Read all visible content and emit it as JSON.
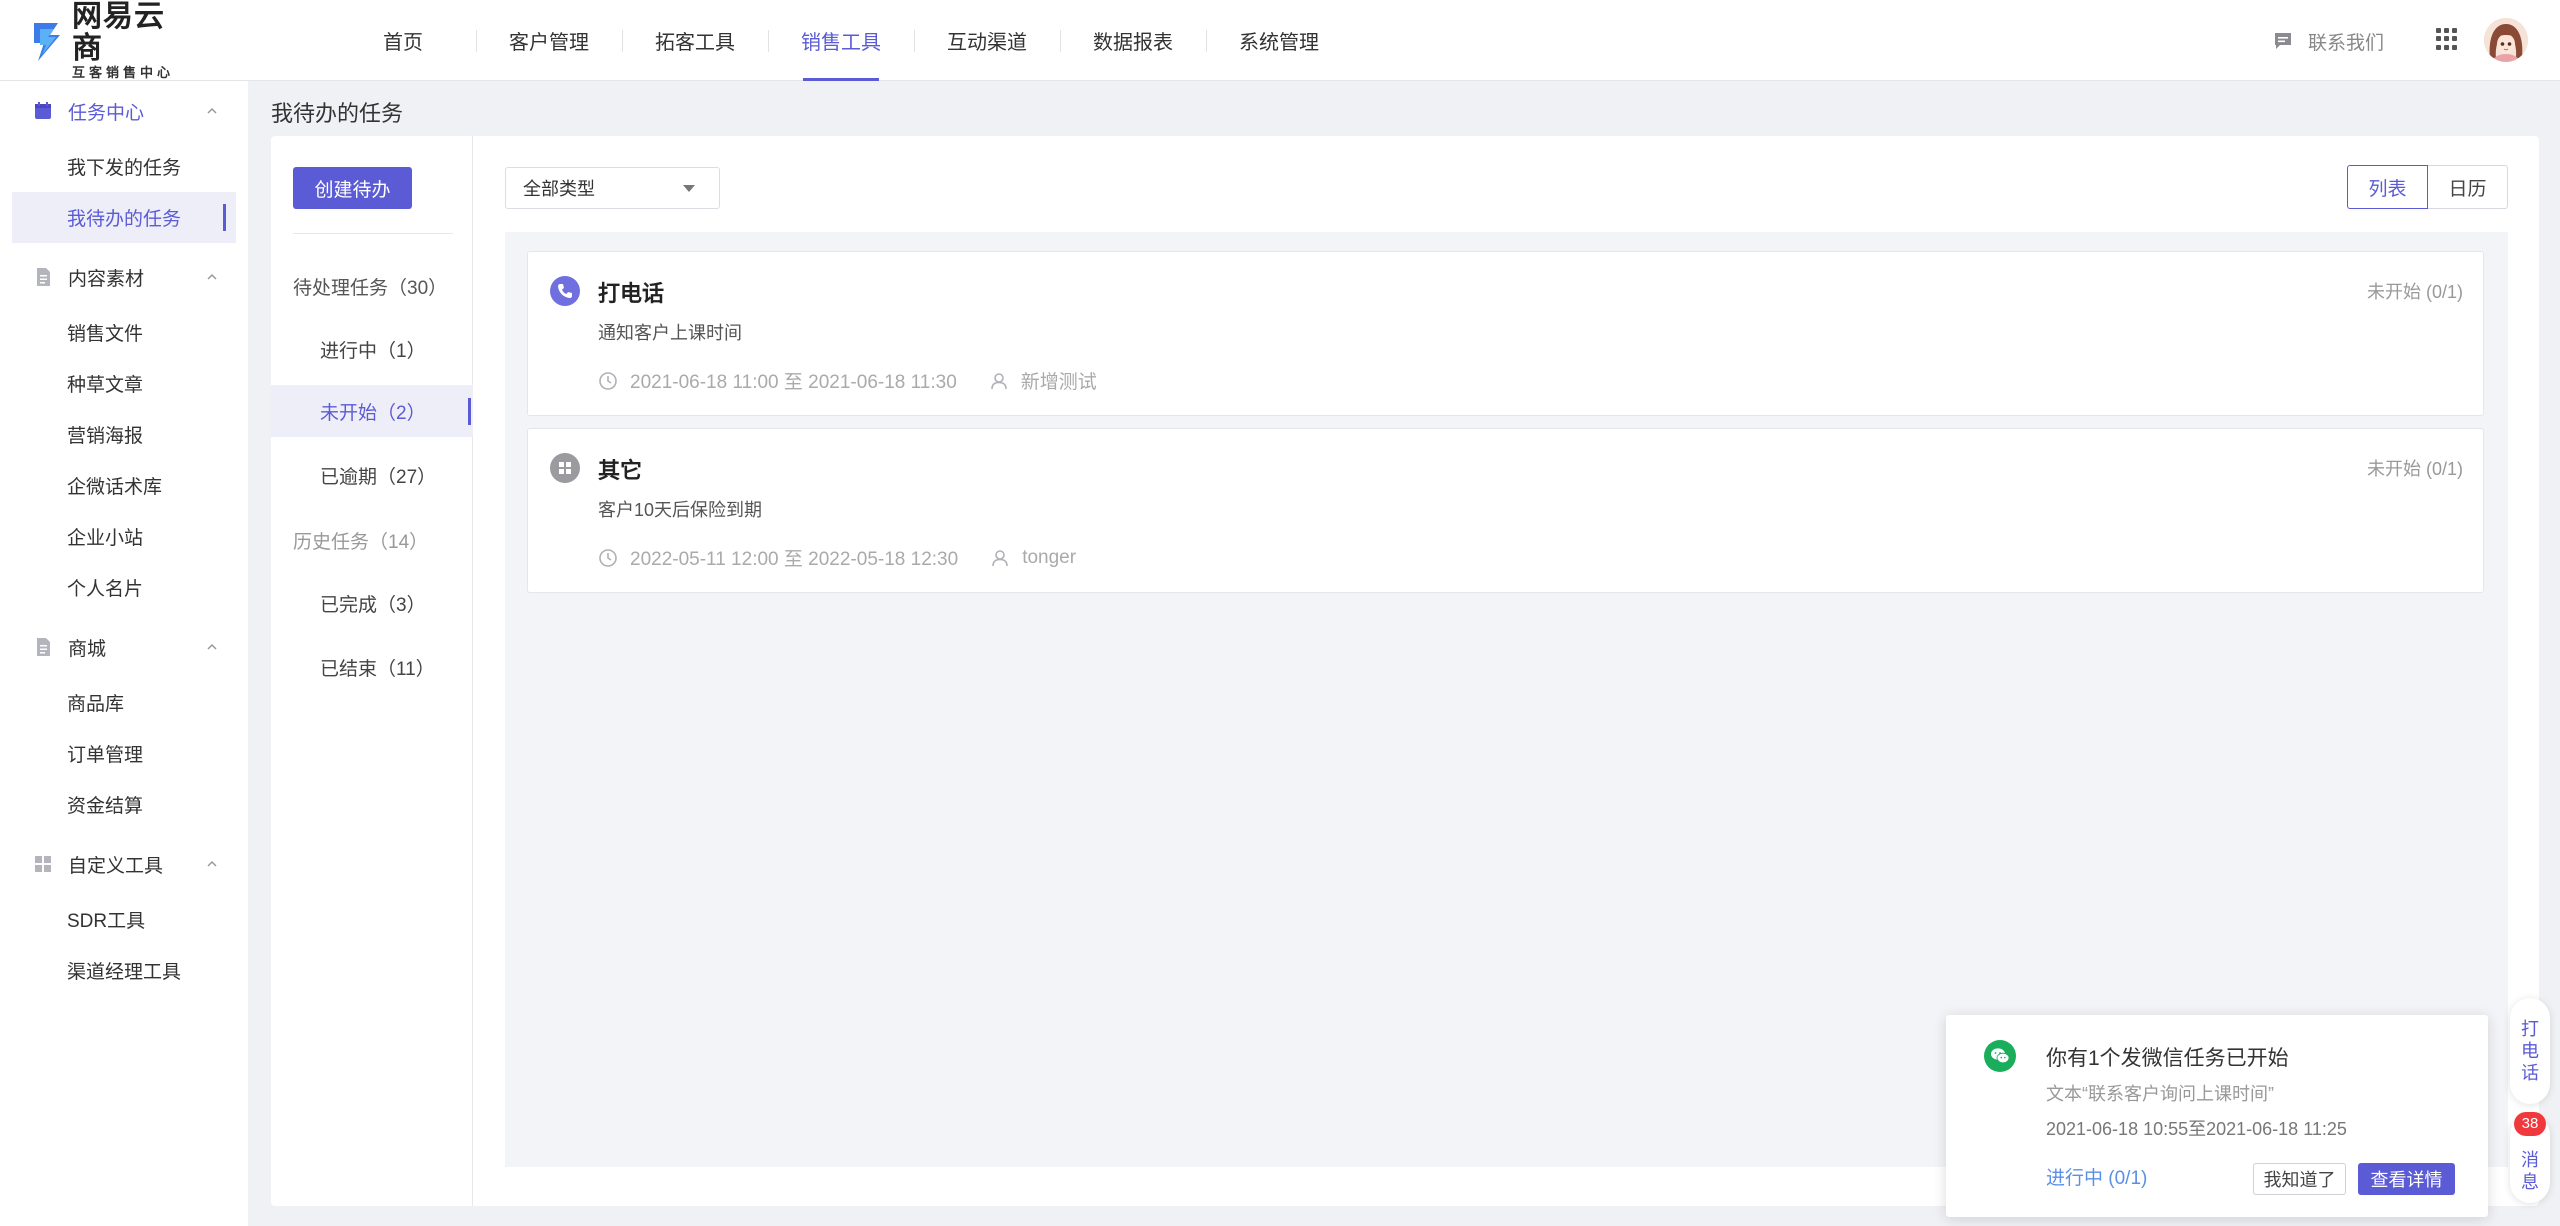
{
  "brand": {
    "name": "网易云商",
    "subtitle": "互客销售中心"
  },
  "nav": {
    "items": [
      {
        "label": "首页"
      },
      {
        "label": "客户管理"
      },
      {
        "label": "拓客工具"
      },
      {
        "label": "销售工具",
        "active": true
      },
      {
        "label": "互动渠道"
      },
      {
        "label": "数据报表"
      },
      {
        "label": "系统管理"
      }
    ],
    "contact_label": "联系我们"
  },
  "sidebar": {
    "groups": [
      {
        "label": "任务中心",
        "icon": "calendar-icon",
        "items": [
          "我下发的任务",
          "我待办的任务"
        ]
      },
      {
        "label": "内容素材",
        "icon": "document-icon",
        "items": [
          "销售文件",
          "种草文章",
          "营销海报",
          "企微话术库",
          "企业小站",
          "个人名片"
        ]
      },
      {
        "label": "商城",
        "icon": "document-icon",
        "items": [
          "商品库",
          "订单管理",
          "资金结算"
        ]
      },
      {
        "label": "自定义工具",
        "icon": "grid-icon",
        "items": [
          "SDR工具",
          "渠道经理工具"
        ]
      }
    ],
    "active_item": "我待办的任务"
  },
  "page": {
    "title": "我待办的任务",
    "create_button": "创建待办"
  },
  "filters": {
    "pending_header": "待处理任务（30）",
    "pending": [
      {
        "label": "进行中（1）"
      },
      {
        "label": "未开始（2）",
        "active": true
      },
      {
        "label": "已逾期（27）"
      }
    ],
    "history_header": "历史任务（14）",
    "history": [
      {
        "label": "已完成（3）"
      },
      {
        "label": "已结束（11）"
      }
    ]
  },
  "toolbar": {
    "type_select_value": "全部类型",
    "view_list": "列表",
    "view_calendar": "日历",
    "active_view": "列表"
  },
  "tasks": [
    {
      "icon": "phone-icon",
      "title": "打电话",
      "status": "未开始 (0/1)",
      "description": "通知客户上课时间",
      "time": "2021-06-18 11:00 至 2021-06-18 11:30",
      "owner": "新增测试"
    },
    {
      "icon": "apps-icon",
      "title": "其它",
      "status": "未开始 (0/1)",
      "description": "客户10天后保险到期",
      "time": "2022-05-11 12:00 至 2022-05-18 12:30",
      "owner": "tonger"
    }
  ],
  "notification": {
    "title": "你有1个发微信任务已开始",
    "text": "文本“联系客户询问上课时间”",
    "time": "2021-06-18 10:55至2021-06-18 11:25",
    "progress": "进行中 (0/1)",
    "ack_button": "我知道了",
    "detail_button": "查看详情"
  },
  "floating": {
    "call_chars": [
      "打",
      "电",
      "话"
    ],
    "msg_chars": [
      "消",
      "息"
    ],
    "msg_badge": "38"
  },
  "colors": {
    "accent": "#5b5bd6",
    "wechat": "#1aad5b",
    "badge": "#f0393d"
  }
}
